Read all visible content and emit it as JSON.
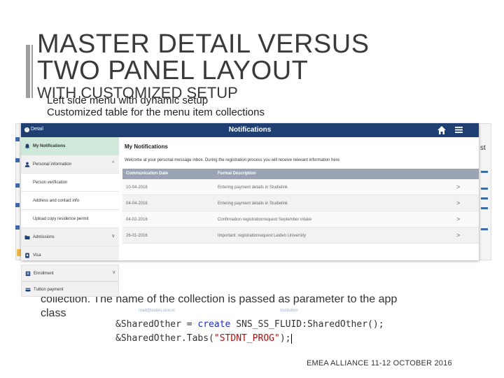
{
  "slide": {
    "title_line1": "MASTER DETAIL VERSUS",
    "title_line2": "TWO PANEL LAYOUT",
    "subtitle": "WITH CUSTOMIZED SETUP",
    "bullets": [
      "Left side menu with dynamic setup",
      "Customized table for the menu item collections"
    ],
    "body_line1": "collection. The name of the collection is passed as parameter to the app",
    "body_line2": "class",
    "footer": "EMEA ALLIANCE   11-12 OCTOBER 2016"
  },
  "app": {
    "back_label": "Detail",
    "header_title": "Notifications",
    "header_color": "#1f3f73",
    "icons": {
      "home": "home-icon",
      "menu": "hamburger-menu-icon"
    },
    "sidebar": {
      "items": [
        {
          "label": "My Notifications",
          "icon": "bell-icon",
          "state": "active"
        },
        {
          "label": "Personal information",
          "icon": "person-icon",
          "state": "group",
          "chevron": "^"
        },
        {
          "label": "Person verification",
          "state": "sub"
        },
        {
          "label": "Address and contact info",
          "state": "sub"
        },
        {
          "label": "Upload copy residence permit",
          "state": "sub"
        },
        {
          "label": "Admissions",
          "icon": "folder-icon",
          "state": "group",
          "chevron": "v"
        },
        {
          "label": "Visa",
          "icon": "passport-icon",
          "state": "group"
        },
        {
          "label": "Enrollment",
          "icon": "enrollment-icon",
          "state": "group",
          "chevron": "v"
        },
        {
          "label": "Tuition payment",
          "icon": "payment-icon",
          "state": "group"
        }
      ]
    },
    "content": {
      "title": "My Notifications",
      "welcome": "Welcome at your personal message inbox. During the registration process you will receive relevant information here",
      "columns": [
        "Communication Date",
        "Formal Description"
      ],
      "rows": [
        {
          "date": "10-04-2016",
          "description": "Entering payment details in Studielink"
        },
        {
          "date": "04-04-2016",
          "description": "Entering payment details in Studielink"
        },
        {
          "date": "04-02-2016",
          "description": "Confirmation registrationrequest September intake"
        },
        {
          "date": "26-01-2016",
          "description": "Important: registrationrequest Leiden University"
        }
      ],
      "row_chevron": ">"
    }
  },
  "background_shot": {
    "partial_label": "st"
  },
  "code": {
    "faint_left": "mail@leiden.univ.nl",
    "faint_right": "Institution",
    "line1_var": "&SharedOther",
    "line1_op": " = ",
    "line1_kw": "create",
    "line1_rest": " SNS_SS_FLUID:SharedOther();",
    "line2_prefix": "&SharedOther.Tabs(",
    "line2_str": "\"STDNT_PROG\"",
    "line2_suffix": ");"
  }
}
